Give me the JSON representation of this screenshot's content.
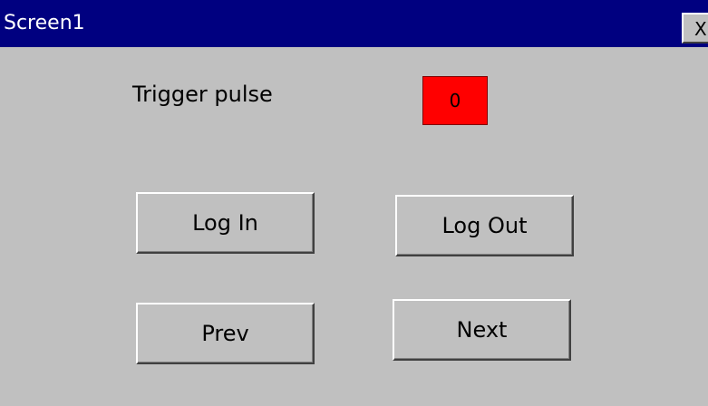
{
  "window": {
    "title": "Screen1",
    "close_label": "X"
  },
  "trigger": {
    "label": "Trigger pulse",
    "value": "0",
    "indicator_color": "#ff0000"
  },
  "buttons": {
    "login": "Log In",
    "logout": "Log Out",
    "prev": "Prev",
    "next": "Next"
  },
  "colors": {
    "titlebar": "#000080",
    "background": "#c0c0c0"
  }
}
